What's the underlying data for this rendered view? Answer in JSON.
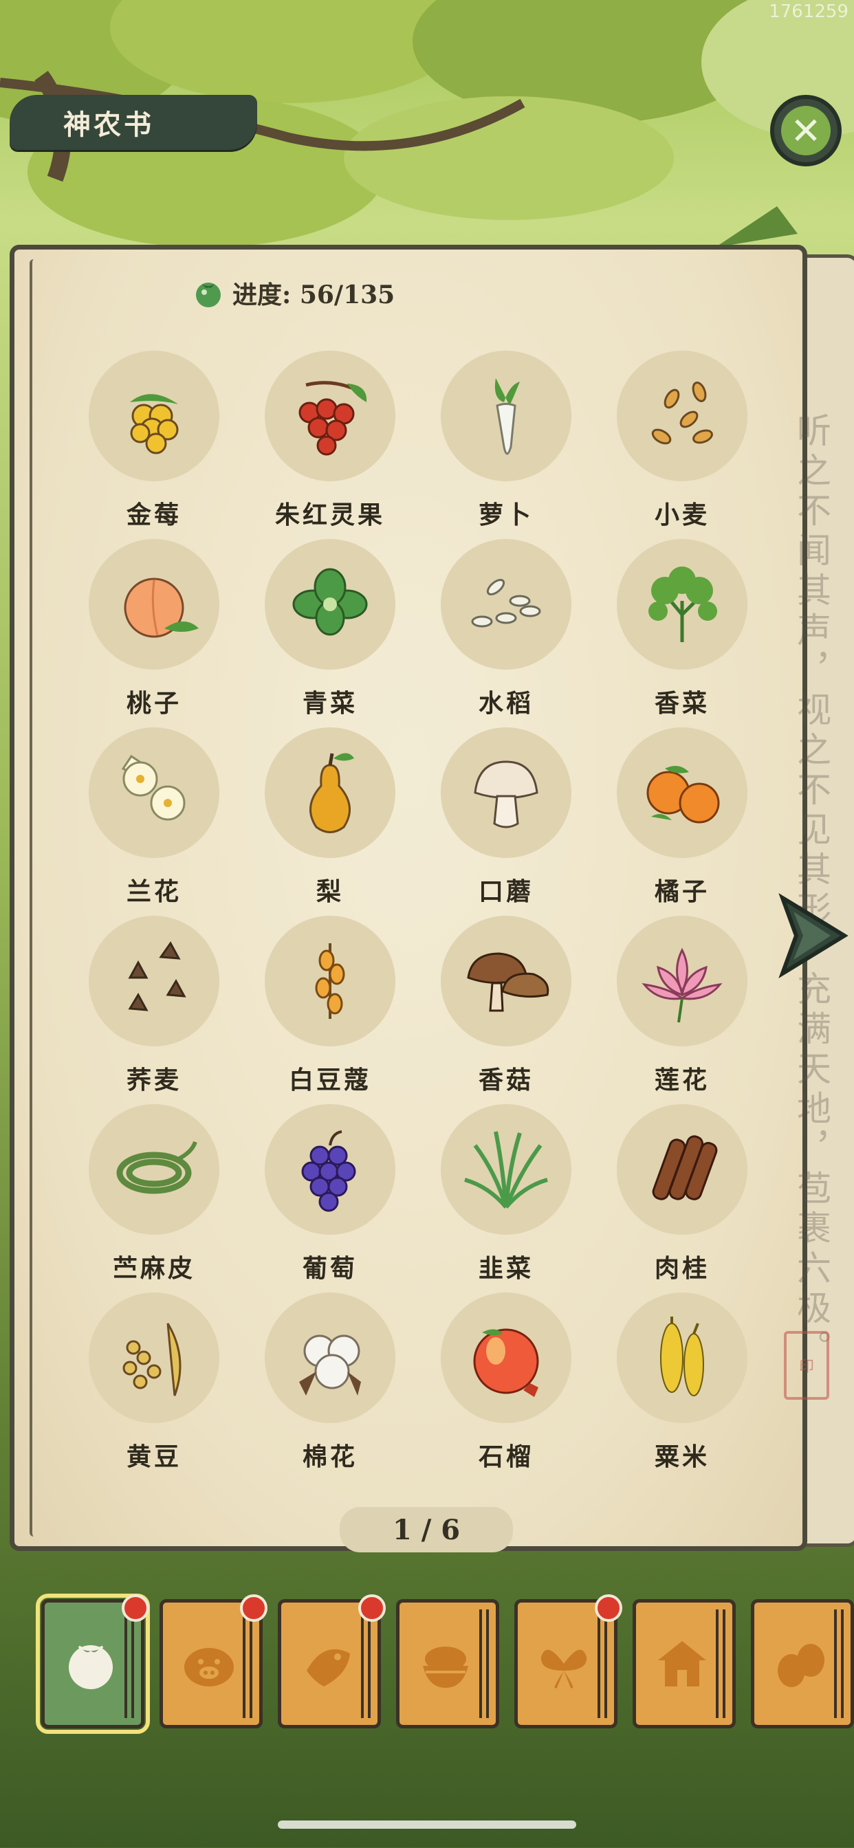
{
  "watermark": "1761259",
  "header": {
    "title": "神农书",
    "close_icon": "close-icon"
  },
  "progress": {
    "label": "进度: 56/135",
    "icon": "tomato-icon"
  },
  "calligraphy": "听之不闻其声，视之不见其形，充满天地，苞裹六极。",
  "items": [
    {
      "name": "金莓",
      "icon": "golden-berry-icon",
      "color": "#f0c230"
    },
    {
      "name": "朱红灵果",
      "icon": "red-fruit-icon",
      "color": "#d23b2a"
    },
    {
      "name": "萝卜",
      "icon": "radish-icon",
      "color": "#f5f5f0"
    },
    {
      "name": "小麦",
      "icon": "wheat-grain-icon",
      "color": "#e1a64a"
    },
    {
      "name": "桃子",
      "icon": "peach-icon",
      "color": "#f4a16b"
    },
    {
      "name": "青菜",
      "icon": "greens-icon",
      "color": "#4c9a45"
    },
    {
      "name": "水稻",
      "icon": "rice-grain-icon",
      "color": "#f3f0e4"
    },
    {
      "name": "香菜",
      "icon": "coriander-icon",
      "color": "#5fa43d"
    },
    {
      "name": "兰花",
      "icon": "orchid-icon",
      "color": "#fbf6d8"
    },
    {
      "name": "梨",
      "icon": "pear-icon",
      "color": "#e8a624"
    },
    {
      "name": "口蘑",
      "icon": "white-mushroom-icon",
      "color": "#f1e6d3"
    },
    {
      "name": "橘子",
      "icon": "orange-icon",
      "color": "#f08a2a"
    },
    {
      "name": "荞麦",
      "icon": "buckwheat-icon",
      "color": "#6b4a34"
    },
    {
      "name": "白豆蔻",
      "icon": "cardamom-icon",
      "color": "#f0a83a"
    },
    {
      "name": "香菇",
      "icon": "shiitake-icon",
      "color": "#8a5631"
    },
    {
      "name": "莲花",
      "icon": "lotus-icon",
      "color": "#ef9bb8"
    },
    {
      "name": "苎麻皮",
      "icon": "ramie-icon",
      "color": "#5d8a3e"
    },
    {
      "name": "葡萄",
      "icon": "grape-icon",
      "color": "#5a45b8"
    },
    {
      "name": "韭菜",
      "icon": "chive-icon",
      "color": "#4a9a4a"
    },
    {
      "name": "肉桂",
      "icon": "cinnamon-icon",
      "color": "#8a4b28"
    },
    {
      "name": "黄豆",
      "icon": "soybean-icon",
      "color": "#e3c15a"
    },
    {
      "name": "棉花",
      "icon": "cotton-icon",
      "color": "#f6f4ef"
    },
    {
      "name": "石榴",
      "icon": "pomegranate-icon",
      "color": "#ee5a3a"
    },
    {
      "name": "粟米",
      "icon": "millet-icon",
      "color": "#ecc935"
    }
  ],
  "page": "1 / 6",
  "tabs": [
    {
      "icon": "tomato-icon",
      "active": true,
      "badge": true
    },
    {
      "icon": "pig-icon",
      "active": false,
      "badge": true
    },
    {
      "icon": "fish-icon",
      "active": false,
      "badge": true
    },
    {
      "icon": "rice-bowl-icon",
      "active": false,
      "badge": false
    },
    {
      "icon": "butterfly-icon",
      "active": false,
      "badge": true
    },
    {
      "icon": "house-icon",
      "active": false,
      "badge": false
    },
    {
      "icon": "beans-icon",
      "active": false,
      "badge": false
    }
  ],
  "colors": {
    "accent": "#6c9a5e",
    "tab": "#e2a24a",
    "badge": "#d93a2c",
    "paper": "#ece1c3"
  }
}
